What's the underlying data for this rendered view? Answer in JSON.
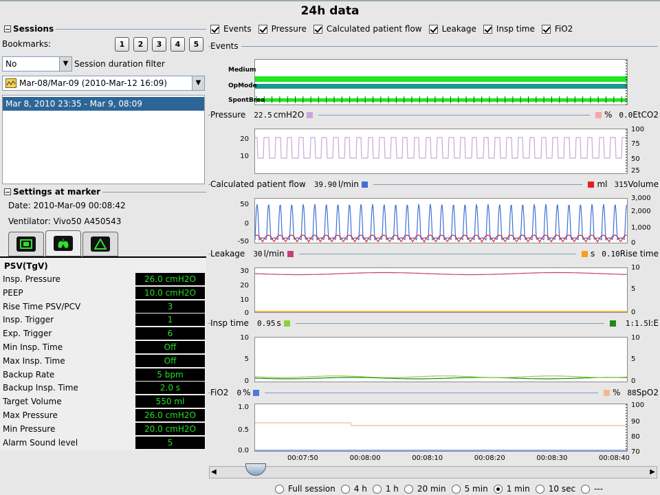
{
  "title": "24h data",
  "sessions": {
    "title": "Sessions",
    "bookmarks_label": "Bookmarks:",
    "bookmarks": [
      "1",
      "2",
      "3",
      "4",
      "5"
    ],
    "filter_value": "No",
    "filter_label": "Session duration filter",
    "range_value": "Mar-08/Mar-09 (2010-Mar-12 16:09)",
    "list": [
      "Mar 8, 2010 23:35 -  Mar 9, 08:09"
    ]
  },
  "settings": {
    "title": "Settings at marker",
    "date": "Date: 2010-Mar-09 00:08:42",
    "ventilator": "Ventilator: Vivo50 A450543",
    "tabs": [
      "monitor-icon",
      "lungs-icon",
      "alarm-triangle-icon"
    ],
    "mode": "PSV(TgV)",
    "params": [
      {
        "label": "Insp. Pressure",
        "value": "26.0 cmH2O"
      },
      {
        "label": "PEEP",
        "value": "10.0 cmH2O"
      },
      {
        "label": "Rise Time PSV/PCV",
        "value": "3"
      },
      {
        "label": "Insp. Trigger",
        "value": "1"
      },
      {
        "label": "Exp. Trigger",
        "value": "6"
      },
      {
        "label": "Min Insp. Time",
        "value": "Off"
      },
      {
        "label": "Max Insp. Time",
        "value": "Off"
      },
      {
        "label": "Backup Rate",
        "value": "5 bpm"
      },
      {
        "label": "Backup Insp. Time",
        "value": "2.0 s"
      },
      {
        "label": "Target Volume",
        "value": "550 ml"
      },
      {
        "label": "Max Pressure",
        "value": "26.0 cmH2O"
      },
      {
        "label": "Min Pressure",
        "value": "20.0 cmH2O"
      },
      {
        "label": "Alarm Sound level",
        "value": "5"
      }
    ]
  },
  "checks": [
    "Events",
    "Pressure",
    "Calculated patient flow",
    "Leakage",
    "Insp time",
    "FiO2"
  ],
  "events": {
    "label": "Events",
    "rows": [
      "Medium",
      "OpMode",
      "SpontBrea"
    ]
  },
  "pressure": {
    "label": "Pressure",
    "value": "22.5",
    "unit": "cmH2O",
    "r_unit": "%",
    "r_value": "0.0",
    "r_label": "EtCO2",
    "l_ticks": [
      "20",
      "10"
    ],
    "r_ticks": [
      "100",
      "75",
      "50",
      "25"
    ],
    "color": "#c9a6dc",
    "r_color": "#f4a7a7"
  },
  "flow": {
    "label": "Calculated patient flow",
    "value": "39.90",
    "unit": "l/min",
    "r_unit": "ml",
    "r_value": "315",
    "r_label": "Volume",
    "l_ticks": [
      "50",
      "0",
      "-50"
    ],
    "r_ticks": [
      "3,000",
      "2,000",
      "1,000",
      "0"
    ],
    "color": "#3a6fd8",
    "r_color": "#e22020"
  },
  "leakage": {
    "label": "Leakage",
    "value": "30",
    "unit": "l/min",
    "r_unit": "s",
    "r_value": "0.10",
    "r_label": "Rise time",
    "l_ticks": [
      "30",
      "20",
      "10",
      "0"
    ],
    "r_ticks": [
      "10",
      "5",
      "0"
    ],
    "color": "#c0407a",
    "r_color": "#f4a020"
  },
  "insp": {
    "label": "Insp time",
    "value": "0.95",
    "unit": "s",
    "r_value": "1:1.5",
    "r_label": "I:E",
    "l_ticks": [
      "10",
      "5",
      "0"
    ],
    "r_ticks": [
      "10",
      "5",
      "0"
    ],
    "color": "#8fd040",
    "r_color": "#1a8a1a"
  },
  "fio2": {
    "label": "FiO2",
    "value": "0",
    "unit": "%",
    "r_unit": "%",
    "r_value": "88",
    "r_label": "SpO2",
    "l_ticks": [
      "1.0",
      "0.5",
      "0.0"
    ],
    "r_ticks": [
      "100",
      "90",
      "80",
      "70"
    ],
    "color": "#4a7ae0",
    "r_color": "#f4b890"
  },
  "x_ticks": [
    "00:07:50",
    "00:08:00",
    "00:08:10",
    "00:08:20",
    "00:08:30",
    "00:08:40"
  ],
  "ranges": [
    {
      "label": "Full session",
      "on": false
    },
    {
      "label": "4 h",
      "on": false
    },
    {
      "label": "1 h",
      "on": false
    },
    {
      "label": "20 min",
      "on": false
    },
    {
      "label": "5 min",
      "on": false
    },
    {
      "label": "1 min",
      "on": true
    },
    {
      "label": "10 sec",
      "on": false
    },
    {
      "label": "---",
      "on": false
    }
  ]
}
